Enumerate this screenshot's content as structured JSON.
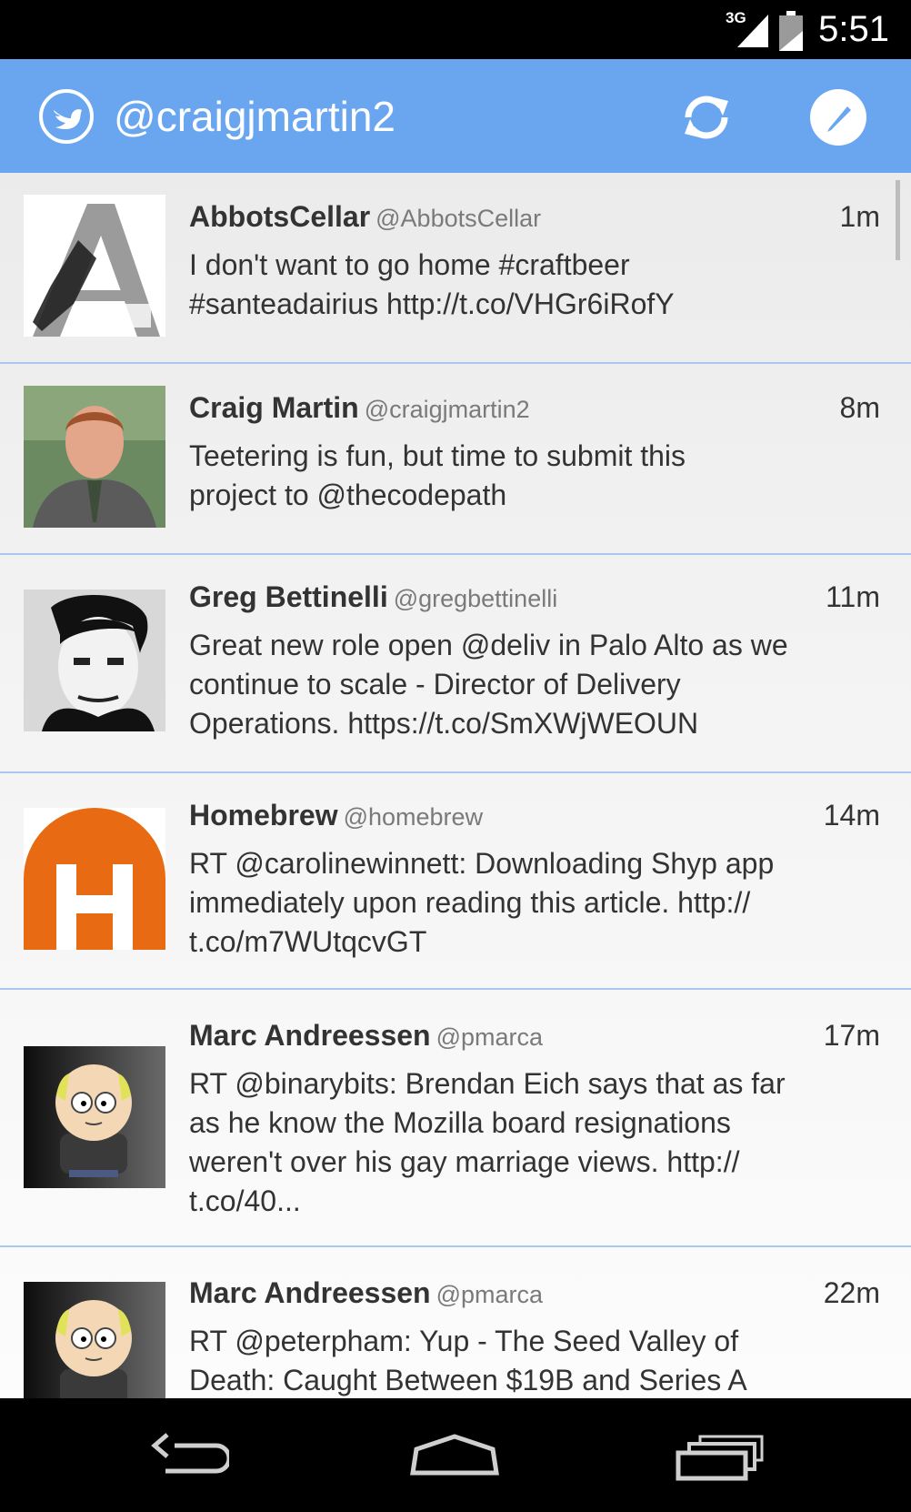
{
  "status_bar": {
    "network": "3G",
    "time": "5:51"
  },
  "action_bar": {
    "title": "@craigjmartin2",
    "logo_icon": "twitter-bird-icon",
    "refresh_icon": "refresh-icon",
    "compose_icon": "compose-icon",
    "color": "#6aa6f0"
  },
  "timeline": {
    "tweets": [
      {
        "name": "AbbotsCellar",
        "handle": "@AbbotsCellar",
        "time": "1m",
        "text": "I don't want to go home #craftbeer\n#santeadairius http://t.co/VHGr6iRofY"
      },
      {
        "name": "Craig Martin",
        "handle": "@craigjmartin2",
        "time": "8m",
        "text": "Teetering is fun, but time to submit this\nproject to @thecodepath"
      },
      {
        "name": "Greg Bettinelli",
        "handle": "@gregbettinelli",
        "time": "11m",
        "text": "Great new role open @deliv in Palo Alto as we\ncontinue to scale - Director of Delivery\nOperations. https://t.co/SmXWjWEOUN"
      },
      {
        "name": "Homebrew",
        "handle": "@homebrew",
        "time": "14m",
        "text": "RT @carolinewinnett: Downloading Shyp app\nimmediately upon reading this article. http://\nt.co/m7WUtqcvGT"
      },
      {
        "name": "Marc Andreessen",
        "handle": "@pmarca",
        "time": "17m",
        "text": "RT @binarybits: Brendan Eich says that as far\nas he know the Mozilla board resignations\nweren't over his gay marriage views. http://\nt.co/40..."
      },
      {
        "name": "Marc Andreessen",
        "handle": "@pmarca",
        "time": "22m",
        "text": "RT @peterpham: Yup - The Seed Valley of\nDeath: Caught Between $19B and Series A"
      }
    ]
  },
  "nav_bar": {
    "back_icon": "back-icon",
    "home_icon": "home-icon",
    "recents_icon": "recent-apps-icon"
  }
}
